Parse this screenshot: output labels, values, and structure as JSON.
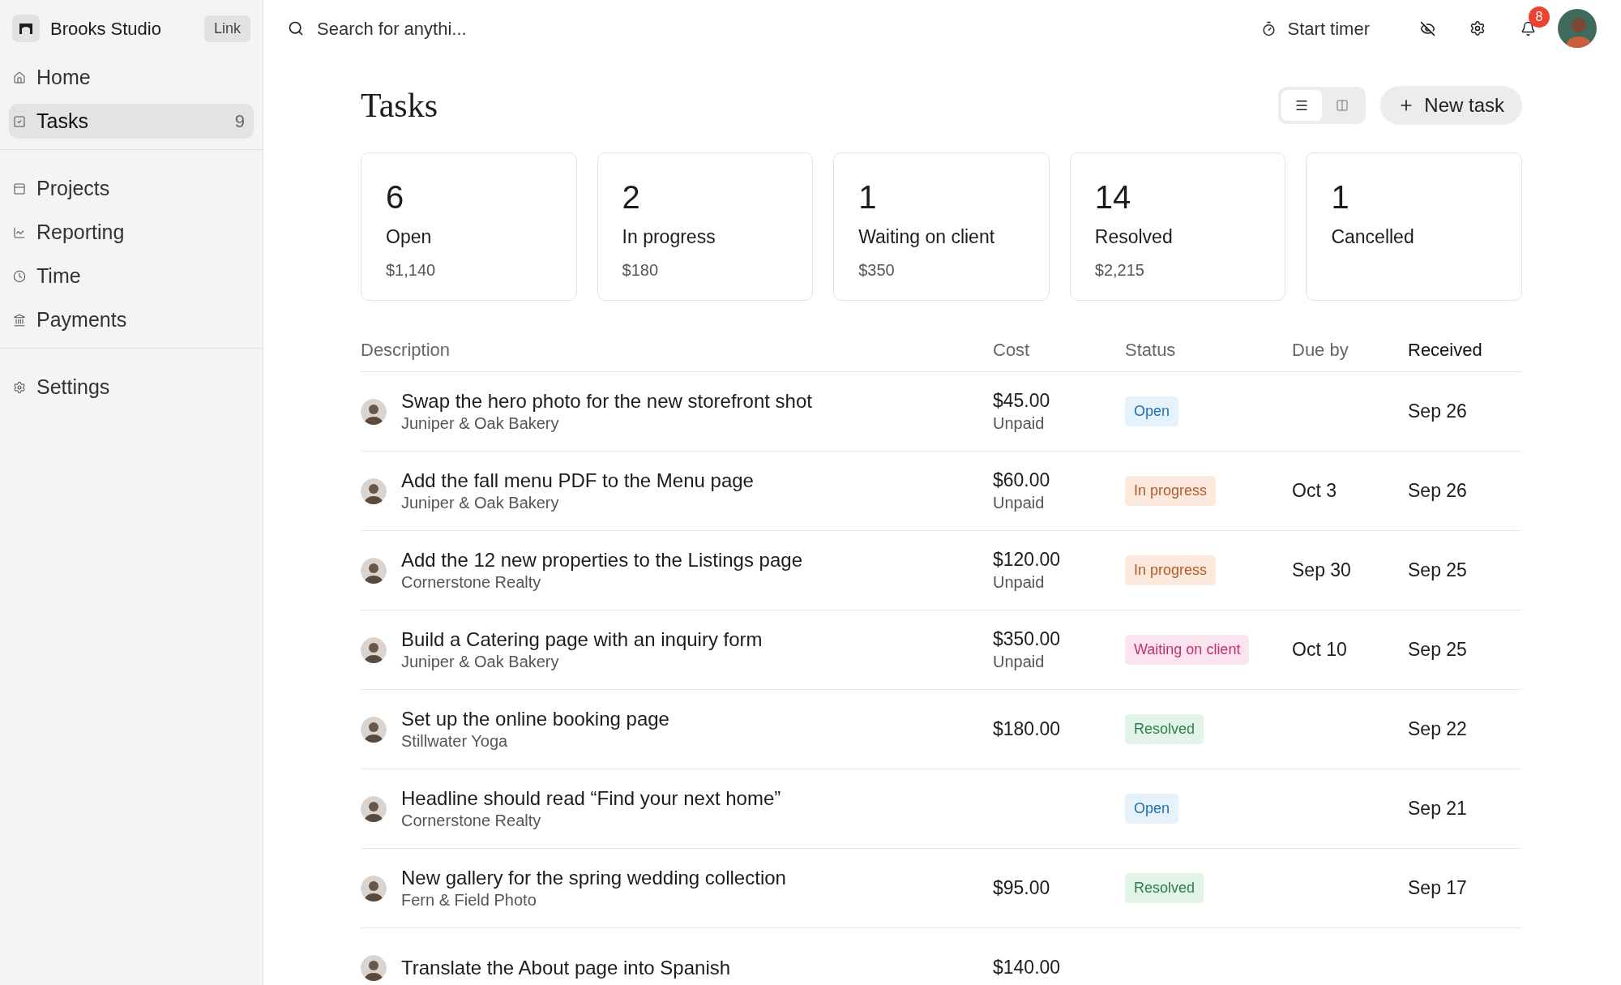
{
  "sidebar": {
    "workspace": "Brooks Studio",
    "link_button": "Link",
    "groups": [
      [
        {
          "kind": "home",
          "label": "Home",
          "selected": false
        },
        {
          "kind": "tasks",
          "label": "Tasks",
          "count": "9",
          "selected": true
        }
      ],
      [
        {
          "kind": "projects",
          "label": "Projects",
          "selected": false
        },
        {
          "kind": "reporting",
          "label": "Reporting",
          "selected": false
        },
        {
          "kind": "time",
          "label": "Time",
          "selected": false
        },
        {
          "kind": "payments",
          "label": "Payments",
          "selected": false
        }
      ],
      [
        {
          "kind": "settings",
          "label": "Settings",
          "selected": false
        }
      ]
    ]
  },
  "topbar": {
    "search": {
      "placeholder": "Search for anythi..."
    },
    "timer_button": "Start timer",
    "notifications_badge": "8"
  },
  "page": {
    "title": "Tasks",
    "view_toggle": [
      {
        "kind": "list",
        "selected": true
      },
      {
        "kind": "board",
        "selected": false
      }
    ],
    "new_button": "New task"
  },
  "stats": [
    {
      "count": "6",
      "label": "Open",
      "amount": "$1,140"
    },
    {
      "count": "2",
      "label": "In progress",
      "amount": "$180"
    },
    {
      "count": "1",
      "label": "Waiting on client",
      "amount": "$350"
    },
    {
      "count": "14",
      "label": "Resolved",
      "amount": "$2,215"
    },
    {
      "count": "1",
      "label": "Cancelled"
    }
  ],
  "table": {
    "columns": [
      {
        "label": "Description",
        "sorted": false
      },
      {
        "label": "Cost",
        "sorted": false
      },
      {
        "label": "Status",
        "sorted": false
      },
      {
        "label": "Due by",
        "sorted": false
      },
      {
        "label": "Received",
        "sorted": true
      }
    ],
    "rows": [
      {
        "title": "Swap the hero photo for the new storefront shot",
        "client": "Juniper & Oak Bakery",
        "cost": "$45.00",
        "payment": "Unpaid",
        "status": {
          "label": "Open",
          "kind": "open"
        },
        "received": "Sep 26"
      },
      {
        "title": "Add the fall menu PDF to the Menu page",
        "client": "Juniper & Oak Bakery",
        "cost": "$60.00",
        "payment": "Unpaid",
        "status": {
          "label": "In progress",
          "kind": "in_progress"
        },
        "due": "Oct 3",
        "received": "Sep 26"
      },
      {
        "title": "Add the 12 new properties to the Listings page",
        "client": "Cornerstone Realty",
        "cost": "$120.00",
        "payment": "Unpaid",
        "status": {
          "label": "In progress",
          "kind": "in_progress"
        },
        "due": "Sep 30",
        "received": "Sep 25"
      },
      {
        "title": "Build a Catering page with an inquiry form",
        "client": "Juniper & Oak Bakery",
        "cost": "$350.00",
        "payment": "Unpaid",
        "status": {
          "label": "Waiting on client",
          "kind": "waiting"
        },
        "due": "Oct 10",
        "received": "Sep 25"
      },
      {
        "title": "Set up the online booking page",
        "client": "Stillwater Yoga",
        "cost": "$180.00",
        "status": {
          "label": "Resolved",
          "kind": "resolved"
        },
        "received": "Sep 22"
      },
      {
        "title": "Headline should read “Find your next home”",
        "client": "Cornerstone Realty",
        "status": {
          "label": "Open",
          "kind": "open"
        },
        "received": "Sep 21"
      },
      {
        "title": "New gallery for the spring wedding collection",
        "client": "Fern & Field Photo",
        "cost": "$95.00",
        "status": {
          "label": "Resolved",
          "kind": "resolved"
        },
        "received": "Sep 17"
      },
      {
        "title": "Translate the About page into Spanish",
        "cost": "$140.00"
      }
    ]
  }
}
